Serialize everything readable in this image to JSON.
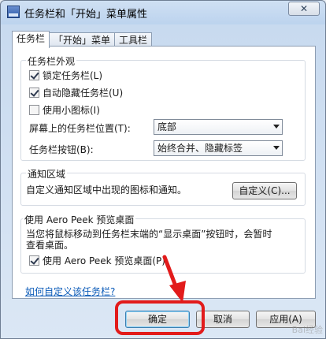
{
  "window": {
    "title": "任务栏和「开始」菜单属性",
    "close_glyph": "✕"
  },
  "tabs": [
    {
      "label": "任务栏",
      "active": true
    },
    {
      "label": "「开始」菜单",
      "active": false
    },
    {
      "label": "工具栏",
      "active": false
    }
  ],
  "appearance": {
    "title": "任务栏外观",
    "lock_taskbar": {
      "label": "锁定任务栏(L)",
      "checked": true
    },
    "auto_hide": {
      "label": "自动隐藏任务栏(U)",
      "checked": true
    },
    "small_icons": {
      "label": "使用小图标(I)",
      "checked": false
    },
    "position_label": "屏幕上的任务栏位置(T):",
    "position_value": "底部",
    "buttons_label": "任务栏按钮(B):",
    "buttons_value": "始终合并、隐藏标签"
  },
  "notification": {
    "title": "通知区域",
    "description": "自定义通知区域中出现的图标和通知。",
    "customize_button": "自定义(C)..."
  },
  "aero_peek": {
    "title": "使用 Aero Peek 预览桌面",
    "desc_line1": "当您将鼠标移动到任务栏末端的“显示桌面”按钮时，会暂时",
    "desc_line2": "查看桌面。",
    "checkbox": {
      "label": "使用 Aero Peek 预览桌面(P)",
      "checked": true
    }
  },
  "help_link": "如何自定义该任务栏?",
  "buttons": {
    "ok": "确定",
    "cancel": "取消",
    "apply": "应用(A)"
  },
  "watermark": "Bai经验",
  "colors": {
    "annotation_red": "#e21b1b",
    "link_blue": "#0a5ab8"
  }
}
